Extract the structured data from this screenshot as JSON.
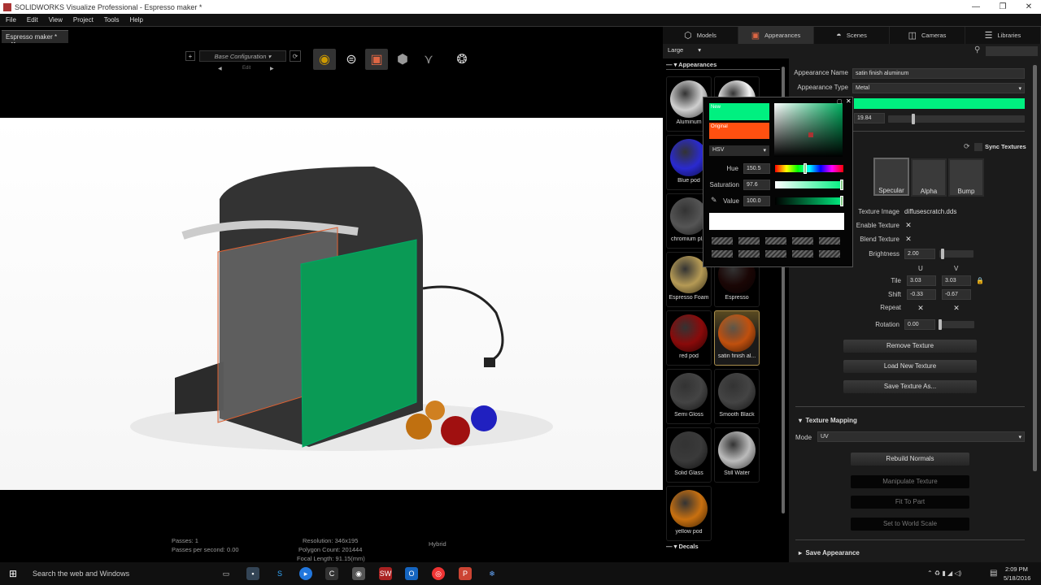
{
  "window": {
    "title": "SOLIDWORKS Visualize Professional - Espresso maker *",
    "minimize": "—",
    "restore": "❐",
    "close": "✕"
  },
  "menu": [
    "File",
    "Edit",
    "View",
    "Project",
    "Tools",
    "Help"
  ],
  "doc_tab": {
    "label": "Espresso maker *",
    "close": "✕"
  },
  "toolbar": {
    "add": "+",
    "configuration": "Base Configuration",
    "edit": "Edit",
    "prev": "◀",
    "next": "▶",
    "refresh": "⟳"
  },
  "status": {
    "passes": "Passes: 1",
    "passes_per_second": "Passes per second: 0.00",
    "resolution": "Resolution: 346x195",
    "polygon_count": "Polygon Count: 201444",
    "focal_length": "Focal Length: 91.15(mm)",
    "mode": "Hybrid"
  },
  "panel_tabs": [
    {
      "label": "Models",
      "icon": "cube-icon"
    },
    {
      "label": "Appearances",
      "icon": "appearance-icon"
    },
    {
      "label": "Scenes",
      "icon": "scene-icon"
    },
    {
      "label": "Cameras",
      "icon": "camera-icon"
    },
    {
      "label": "Libraries",
      "icon": "library-icon"
    }
  ],
  "size_select": "Large",
  "library": {
    "appearances_header": "Appearances",
    "decals_header": "Decals",
    "items": [
      {
        "label": "Aluminum",
        "color": "#cfcfcf"
      },
      {
        "label": "",
        "color": "#f2f2f2"
      },
      {
        "label": "Blue pod",
        "color": "#2a2ad0"
      },
      {
        "label": "",
        "color": "#222"
      },
      {
        "label": "chromium pl...",
        "color": "#555"
      },
      {
        "label": "",
        "color": "#222"
      },
      {
        "label": "Espresso Foam",
        "color": "#b59a55"
      },
      {
        "label": "Espresso",
        "color": "#1a0605"
      },
      {
        "label": "red pod",
        "color": "#8a0a0a"
      },
      {
        "label": "satin finish al...",
        "color": "#c0500e"
      },
      {
        "label": "Semi Gloss",
        "color": "#444"
      },
      {
        "label": "Smooth Black",
        "color": "#444"
      },
      {
        "label": "Solid Glass",
        "color": "#3a3a3a"
      },
      {
        "label": "Still Water",
        "color": "#bbb"
      },
      {
        "label": "yellow pod",
        "color": "#c87010"
      }
    ]
  },
  "properties": {
    "appearance_name_label": "Appearance Name",
    "appearance_name": "satin finish aluminum",
    "appearance_type_label": "Appearance Type",
    "appearance_type": "Metal",
    "color": "#00f080",
    "roughness_value": "19.84",
    "roughness_fraction": 0.17,
    "sync_textures": "Sync Textures",
    "texture_slots": [
      "Specular",
      "Alpha",
      "Bump"
    ],
    "texture_image_label": "Texture Image",
    "texture_image": "diffusescratch.dds",
    "enable_texture_label": "Enable Texture",
    "blend_texture_label": "Blend Texture",
    "checked": "✕",
    "brightness_label": "Brightness",
    "brightness": "2.00",
    "u": "U",
    "v": "V",
    "tile_label": "Tile",
    "tile_u": "3.03",
    "tile_v": "3.03",
    "shift_label": "Shift",
    "shift_u": "-0.33",
    "shift_v": "-0.67",
    "repeat_label": "Repeat",
    "rotation_label": "Rotation",
    "rotation": "0.00",
    "remove_texture": "Remove Texture",
    "load_new_texture": "Load New Texture",
    "save_texture_as": "Save Texture As...",
    "texture_mapping": "Texture Mapping",
    "mode_label": "Mode",
    "mode": "UV",
    "rebuild_normals": "Rebuild Normals",
    "manipulate_texture": "Manipulate Texture",
    "fit_to_part": "Fit To Part",
    "set_to_world_scale": "Set to World Scale",
    "save_appearance": "Save Appearance"
  },
  "color_picker": {
    "new_label": "New",
    "original_label": "Original",
    "new_color": "#00f080",
    "original_color": "#ff5010",
    "model": "HSV",
    "hue_label": "Hue",
    "hue": "150.5",
    "saturation_label": "Saturation",
    "saturation": "97.6",
    "value_label": "Value",
    "value": "100.0"
  },
  "taskbar": {
    "search": "Search the web and Windows",
    "time": "2:09 PM",
    "date": "5/18/2016"
  }
}
